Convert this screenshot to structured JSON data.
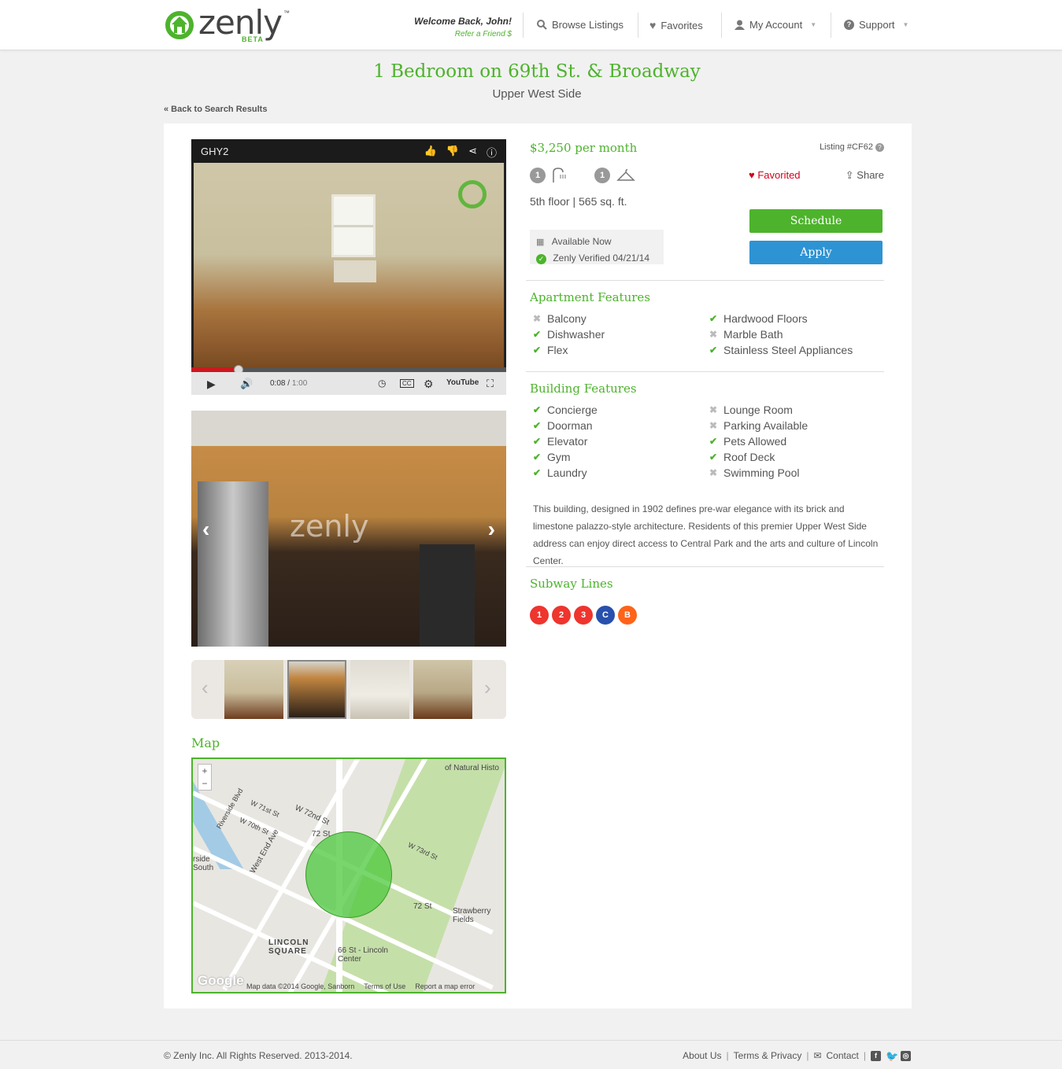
{
  "brand": {
    "name": "zenly",
    "badge": "BETA",
    "trademark": "™"
  },
  "header": {
    "welcome": "Welcome Back, John!",
    "refer": "Refer a Friend $",
    "nav": [
      {
        "label": "Browse Listings",
        "icon": "search-icon"
      },
      {
        "label": "Favorites",
        "icon": "heart-icon"
      },
      {
        "label": "My Account",
        "icon": "user-icon"
      },
      {
        "label": "Support",
        "icon": "question-icon"
      }
    ]
  },
  "page": {
    "title": "1 Bedroom on 69th St. & Broadway",
    "subtitle": "Upper West Side",
    "back_link": "« Back to Search Results"
  },
  "video": {
    "title": "GHY2",
    "time_current": "0:08",
    "time_total": "1:00",
    "progress": 0.15,
    "youtube": "YouTube"
  },
  "photo": {
    "watermark": "zenly"
  },
  "map": {
    "label": "Map",
    "labels": [
      "W 72nd St",
      "W 71st St",
      "W 70th St",
      "West End Ave",
      "Riverside Blvd",
      "72 St",
      "W 73rd St",
      "72 St",
      "Strawberry Fields",
      "LINCOLN SQUARE",
      "66 St - Lincoln Center",
      "of Natural Histo",
      "rside South"
    ],
    "footer": [
      "Map data ©2014 Google, Sanborn",
      "Terms of Use",
      "Report a map error"
    ],
    "google": "Google"
  },
  "listing": {
    "price": "$3,250 per month",
    "listing_no": "Listing #CF62",
    "baths": "1",
    "closets": "1",
    "favorited": "Favorited",
    "share": "Share",
    "floor_info": "5th floor | 565 sq. ft.",
    "available": "Available Now",
    "verified": "Zenly Verified 04/21/14",
    "schedule": "Schedule",
    "apply": "Apply"
  },
  "apartment_features": {
    "title": "Apartment Features",
    "items": [
      {
        "label": "Balcony",
        "has": false
      },
      {
        "label": "Hardwood Floors",
        "has": true
      },
      {
        "label": "Dishwasher",
        "has": true
      },
      {
        "label": "Marble Bath",
        "has": false
      },
      {
        "label": "Flex",
        "has": true
      },
      {
        "label": "Stainless Steel Appliances",
        "has": true
      }
    ]
  },
  "building_features": {
    "title": "Building Features",
    "items": [
      {
        "label": "Concierge",
        "has": true
      },
      {
        "label": "Lounge Room",
        "has": false
      },
      {
        "label": "Doorman",
        "has": true
      },
      {
        "label": "Parking Available",
        "has": false
      },
      {
        "label": "Elevator",
        "has": true
      },
      {
        "label": "Pets Allowed",
        "has": true
      },
      {
        "label": "Gym",
        "has": true
      },
      {
        "label": "Roof Deck",
        "has": true
      },
      {
        "label": "Laundry",
        "has": true
      },
      {
        "label": "Swimming Pool",
        "has": false
      }
    ],
    "description": "This building, designed in 1902 defines pre-war elegance with its brick and limestone palazzo-style architecture. Residents of this premier Upper West Side address can enjoy direct access to Central Park and the arts and culture of Lincoln Center."
  },
  "subway": {
    "title": "Subway Lines",
    "lines": [
      {
        "label": "1",
        "color": "#ee352e"
      },
      {
        "label": "2",
        "color": "#ee352e"
      },
      {
        "label": "3",
        "color": "#ee352e"
      },
      {
        "label": "C",
        "color": "#2850ad"
      },
      {
        "label": "B",
        "color": "#ff6319"
      }
    ]
  },
  "footer": {
    "copyright": "© Zenly Inc. All Rights Reserved. 2013-2014.",
    "links": [
      "About Us",
      "Terms & Privacy",
      "Contact"
    ]
  },
  "colors": {
    "brand_green": "#4db32c",
    "apply_blue": "#2e93d3",
    "favorite_red": "#d0021b"
  }
}
